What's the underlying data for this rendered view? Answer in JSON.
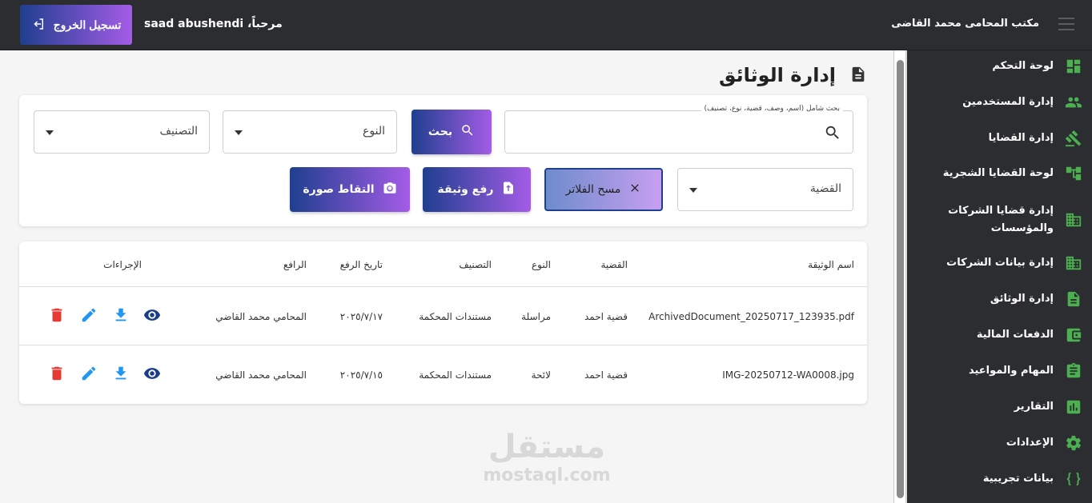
{
  "header": {
    "brand": "مكتب المحامى محمد القاضى",
    "welcome": "مرحباً، saad abushendi",
    "logout_label": "تسجيل الخروج"
  },
  "sidebar": {
    "items": [
      {
        "label": "لوحة التحكم",
        "icon": "dashboard-icon"
      },
      {
        "label": "إدارة المستخدمين",
        "icon": "users-icon"
      },
      {
        "label": "إدارة القضايا",
        "icon": "gavel-icon"
      },
      {
        "label": "لوحة القضايا الشجرية",
        "icon": "tree-icon"
      },
      {
        "label": "إدارة قضايا الشركات والمؤسسات",
        "icon": "building-icon"
      },
      {
        "label": "إدارة بيانات الشركات",
        "icon": "building-icon"
      },
      {
        "label": "إدارة الوثائق",
        "icon": "document-icon"
      },
      {
        "label": "الدفعات المالية",
        "icon": "wallet-icon"
      },
      {
        "label": "المهام والمواعيد",
        "icon": "clipboard-icon"
      },
      {
        "label": "التقارير",
        "icon": "chart-icon"
      },
      {
        "label": "الإعدادات",
        "icon": "gear-icon"
      },
      {
        "label": "بيانات تجريبية",
        "icon": "braces-icon"
      }
    ]
  },
  "page": {
    "title": "إدارة الوثائق"
  },
  "filters": {
    "search_label": "بحث شامل (اسم، وصف، قضية، نوع، تصنيف)",
    "search_value": "",
    "search_button": "بحث",
    "type_select": "النوع",
    "category_select": "التصنيف",
    "case_select": "القضية",
    "clear_button": "مسح الفلاتر",
    "upload_button": "رفع وثيقة",
    "capture_button": "التقاط صورة"
  },
  "table": {
    "headers": [
      "اسم الوثيقة",
      "القضية",
      "النوع",
      "التصنيف",
      "تاريخ الرفع",
      "الرافع",
      "الإجراءات"
    ],
    "rows": [
      {
        "name": "ArchivedDocument_20250717_123935.pdf",
        "case": "قضية احمد",
        "type": "مراسلة",
        "category": "مستندات المحكمة",
        "date": "٢٠٢٥/٧/١٧",
        "uploader": "المحامي محمد القاضي"
      },
      {
        "name": "IMG-20250712-WA0008.jpg",
        "case": "قضية احمد",
        "type": "لائحة",
        "category": "مستندات المحكمة",
        "date": "٢٠٢٥/٧/١٥",
        "uploader": "المحامي محمد القاضي"
      }
    ]
  },
  "watermark": {
    "arabic": "مستقل",
    "latin": "mostaql.com"
  },
  "colors": {
    "accent_green": "#4caf50",
    "gradient_start": "#1f3f8f",
    "gradient_end": "#a45ce6",
    "view_blue": "#1a3d8a",
    "action_blue": "#2196f3",
    "delete_red": "#e53935"
  }
}
